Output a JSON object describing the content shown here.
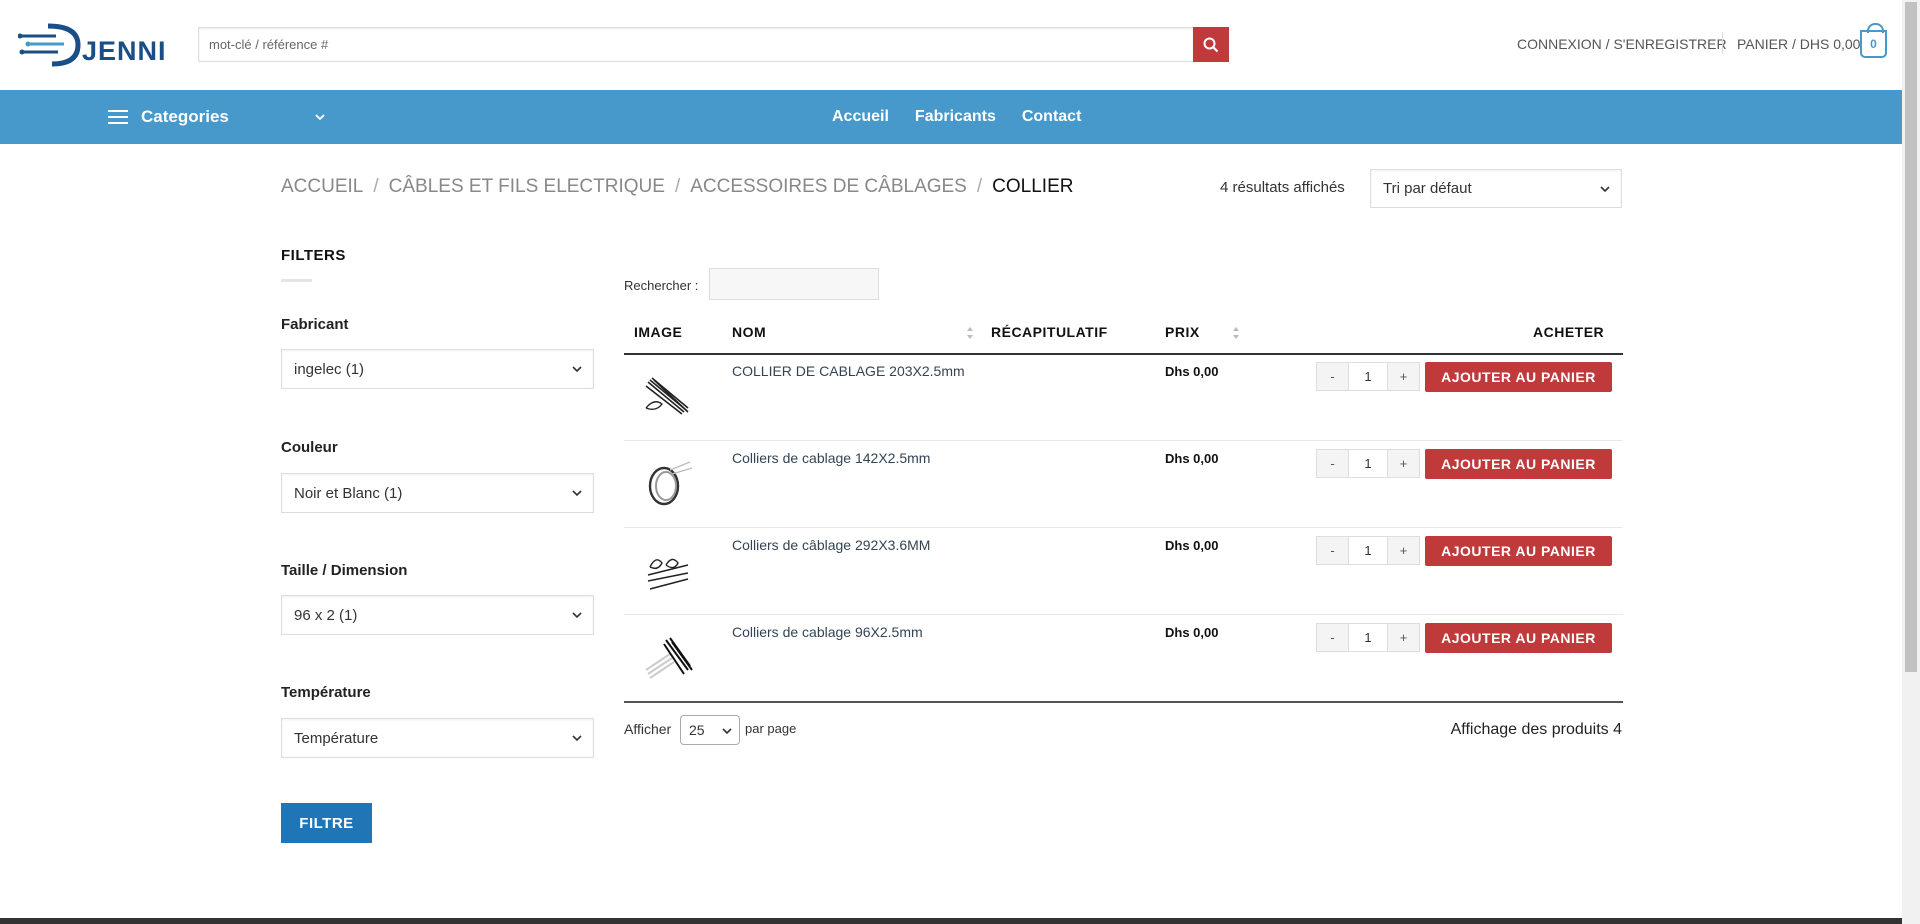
{
  "header": {
    "logo_text": "JENNI",
    "search_placeholder": "mot-clé / référence #",
    "login_label": "CONNEXION / S'ENREGISTRER",
    "cart_label": "PANIER / DHS 0,00",
    "cart_count": "0"
  },
  "nav": {
    "categories_label": "Categories",
    "links": [
      "Accueil",
      "Fabricants",
      "Contact"
    ]
  },
  "breadcrumb": [
    "ACCUEIL",
    "CÂBLES ET FILS ELECTRIQUE",
    "ACCESSOIRES DE CÂBLAGES",
    "COLLIER"
  ],
  "results": {
    "count_text": "4 résultats affichés",
    "sort_value": "Tri par défaut"
  },
  "filters": {
    "title": "FILTERS",
    "groups": [
      {
        "label": "Fabricant",
        "value": "ingelec (1)"
      },
      {
        "label": "Couleur",
        "value": "Noir et Blanc (1)"
      },
      {
        "label": "Taille / Dimension",
        "value": "96 x 2 (1)"
      },
      {
        "label": "Température",
        "value": "Température"
      }
    ],
    "button_label": "FILTRE"
  },
  "table": {
    "search_label": "Rechercher :",
    "columns": [
      "IMAGE",
      "NOM",
      "RÉCAPITULATIF",
      "PRIX",
      "ACHETER"
    ],
    "rows": [
      {
        "name": "COLLIER DE CABLAGE 203X2.5mm",
        "price": "Dhs 0,00",
        "qty": "1",
        "button": "AJOUTER AU PANIER"
      },
      {
        "name": "Colliers de cablage 142X2.5mm",
        "price": "Dhs 0,00",
        "qty": "1",
        "button": "AJOUTER AU PANIER"
      },
      {
        "name": "Colliers de câblage 292X3.6MM",
        "price": "Dhs 0,00",
        "qty": "1",
        "button": "AJOUTER AU PANIER"
      },
      {
        "name": "Colliers de cablage 96X2.5mm",
        "price": "Dhs 0,00",
        "qty": "1",
        "button": "AJOUTER AU PANIER"
      }
    ],
    "qty_minus": "-",
    "qty_plus": "+",
    "show_label": "Afficher",
    "per_page_value": "25",
    "per_page_label": "par page",
    "summary": "Affichage des produits 4"
  },
  "colors": {
    "brand_blue": "#4699ca",
    "accent_red": "#c0393b",
    "filter_button": "#1f75b5"
  }
}
